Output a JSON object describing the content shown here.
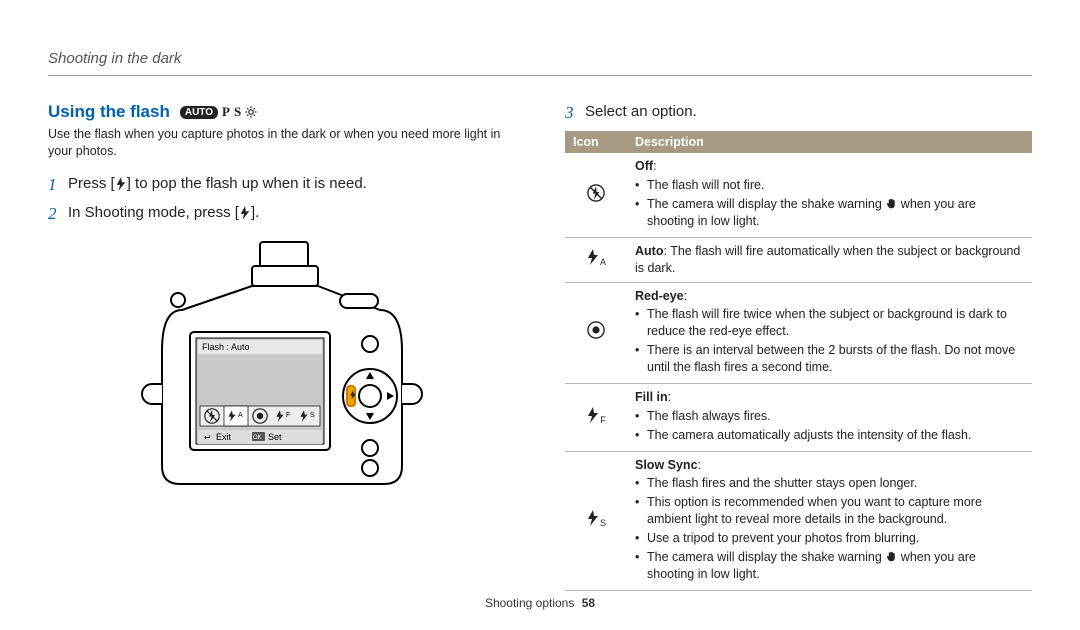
{
  "header": {
    "breadcrumb": "Shooting in the dark"
  },
  "section": {
    "title": "Using the flash",
    "modes": [
      "AUTO",
      "P",
      "S",
      "Gear"
    ],
    "intro": "Use the flash when you capture photos in the dark or when you need more light in your photos."
  },
  "steps": [
    {
      "num": "1",
      "prefix": "Press [",
      "suffix": "] to pop the flash up when it is need."
    },
    {
      "num": "2",
      "prefix": "In Shooting mode, press [",
      "suffix": "]."
    },
    {
      "num": "3",
      "text": "Select an option."
    }
  ],
  "camera_screen": {
    "title": "Flash : Auto",
    "left_soft": "Exit",
    "right_soft": "Set",
    "left_icon": "↩",
    "right_icon": "OK"
  },
  "table": {
    "headers": [
      "Icon",
      "Description"
    ],
    "rows": [
      {
        "icon": "off",
        "title": "Off",
        "bullets": [
          "The flash will not fire.",
          "The camera will display the shake warning [hand] when you are shooting in low light."
        ]
      },
      {
        "icon": "auto",
        "title_inline": "Auto",
        "inline_text": ": The flash will fire automatically when the subject or background is dark."
      },
      {
        "icon": "redeye",
        "title": "Red-eye",
        "bullets": [
          "The flash will fire twice when the subject or background is dark to reduce the red-eye effect.",
          "There is an interval between the 2 bursts of the flash. Do not move until the flash fires a second time."
        ]
      },
      {
        "icon": "fillin",
        "title": "Fill in",
        "bullets": [
          "The flash always fires.",
          "The camera automatically adjusts the intensity of the flash."
        ]
      },
      {
        "icon": "slowsync",
        "title": "Slow Sync",
        "bullets": [
          "The flash fires and the shutter stays open longer.",
          "This option is recommended when you want to capture more ambient light to reveal more details in the background.",
          "Use a tripod to prevent your photos from blurring.",
          "The camera will display the shake warning [hand] when you are shooting in low light."
        ]
      }
    ]
  },
  "footer": {
    "section": "Shooting options",
    "page": "58"
  }
}
